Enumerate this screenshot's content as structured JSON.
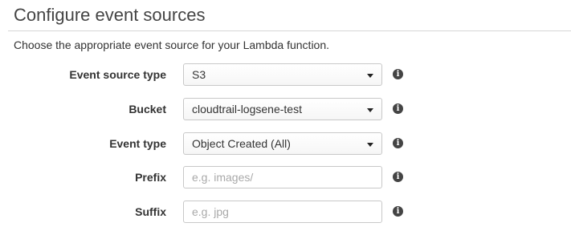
{
  "header": {
    "title": "Configure event sources",
    "description": "Choose the appropriate event source for your Lambda function."
  },
  "form": {
    "event_source_type": {
      "label": "Event source type",
      "value": "S3",
      "icon": "info-icon"
    },
    "bucket": {
      "label": "Bucket",
      "value": "cloudtrail-logsene-test",
      "icon": "info-icon"
    },
    "event_type": {
      "label": "Event type",
      "value": "Object Created (All)",
      "icon": "info-icon"
    },
    "prefix": {
      "label": "Prefix",
      "value": "",
      "placeholder": "e.g. images/",
      "icon": "info-icon"
    },
    "suffix": {
      "label": "Suffix",
      "value": "",
      "placeholder": "e.g. jpg",
      "icon": "info-icon"
    },
    "info_glyph": "i"
  }
}
